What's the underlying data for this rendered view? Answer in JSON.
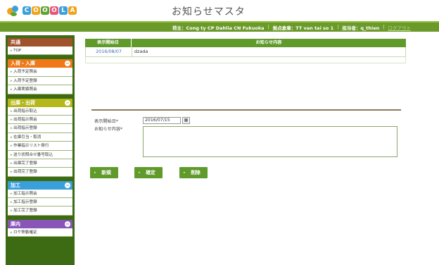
{
  "app": {
    "logo_letters": [
      "C",
      "O",
      "O",
      "O",
      "L",
      "A"
    ],
    "logo_colors": [
      "#3aa0dc",
      "#f0a21a",
      "#5da334",
      "#e8537a",
      "#3aa0dc",
      "#f0a21a"
    ],
    "title": "お知らせマスタ"
  },
  "info_bar": {
    "shipper": "荷主：Cong ty CP Dahlia CN Fukuoka",
    "warehouse": "拠点倉庫：TT van tai so 1",
    "user": "担当者：q_thien",
    "logout": "ログアウト",
    "separator": "|"
  },
  "sidebar": {
    "groups": [
      {
        "title": "共通",
        "color": "#a0522d",
        "has_toggle": false,
        "items": [
          "TOP"
        ]
      },
      {
        "title": "入荷・入庫",
        "color": "#f07818",
        "has_toggle": true,
        "toggle": "−",
        "items": [
          "入荷予定照会",
          "入荷予定登録",
          "入庫実績照会"
        ]
      },
      {
        "title": "出庫・出荷",
        "color": "#b5b81a",
        "has_toggle": true,
        "toggle": "−",
        "items": [
          "出荷指示取込",
          "出荷指示照会",
          "出荷指示登録",
          "在庫引当・取消",
          "作業指示リスト発行",
          "送り状照合せ番号取込",
          "出庫完了登録",
          "出荷完了登録"
        ]
      },
      {
        "title": "加工",
        "color": "#3aa0dc",
        "has_toggle": true,
        "toggle": "−",
        "items": [
          "加工指示照会",
          "加工指示登録",
          "加工完了登録"
        ]
      },
      {
        "title": "庫内",
        "color": "#8a55b8",
        "has_toggle": true,
        "toggle": "−",
        "items": [
          "ロケ移動確定"
        ]
      }
    ]
  },
  "table": {
    "headers": [
      "表示開始日",
      "お知らせ内容"
    ],
    "rows": [
      {
        "date": "2016/08/07",
        "content": "dzada"
      }
    ]
  },
  "form": {
    "start_date_label": "表示開始日*",
    "start_date_value": "2016/07/15",
    "calendar_glyph": "▦",
    "content_label": "お知らせ内容*",
    "content_value": ""
  },
  "buttons": {
    "new": "新規",
    "confirm": "確定",
    "delete": "削除"
  }
}
